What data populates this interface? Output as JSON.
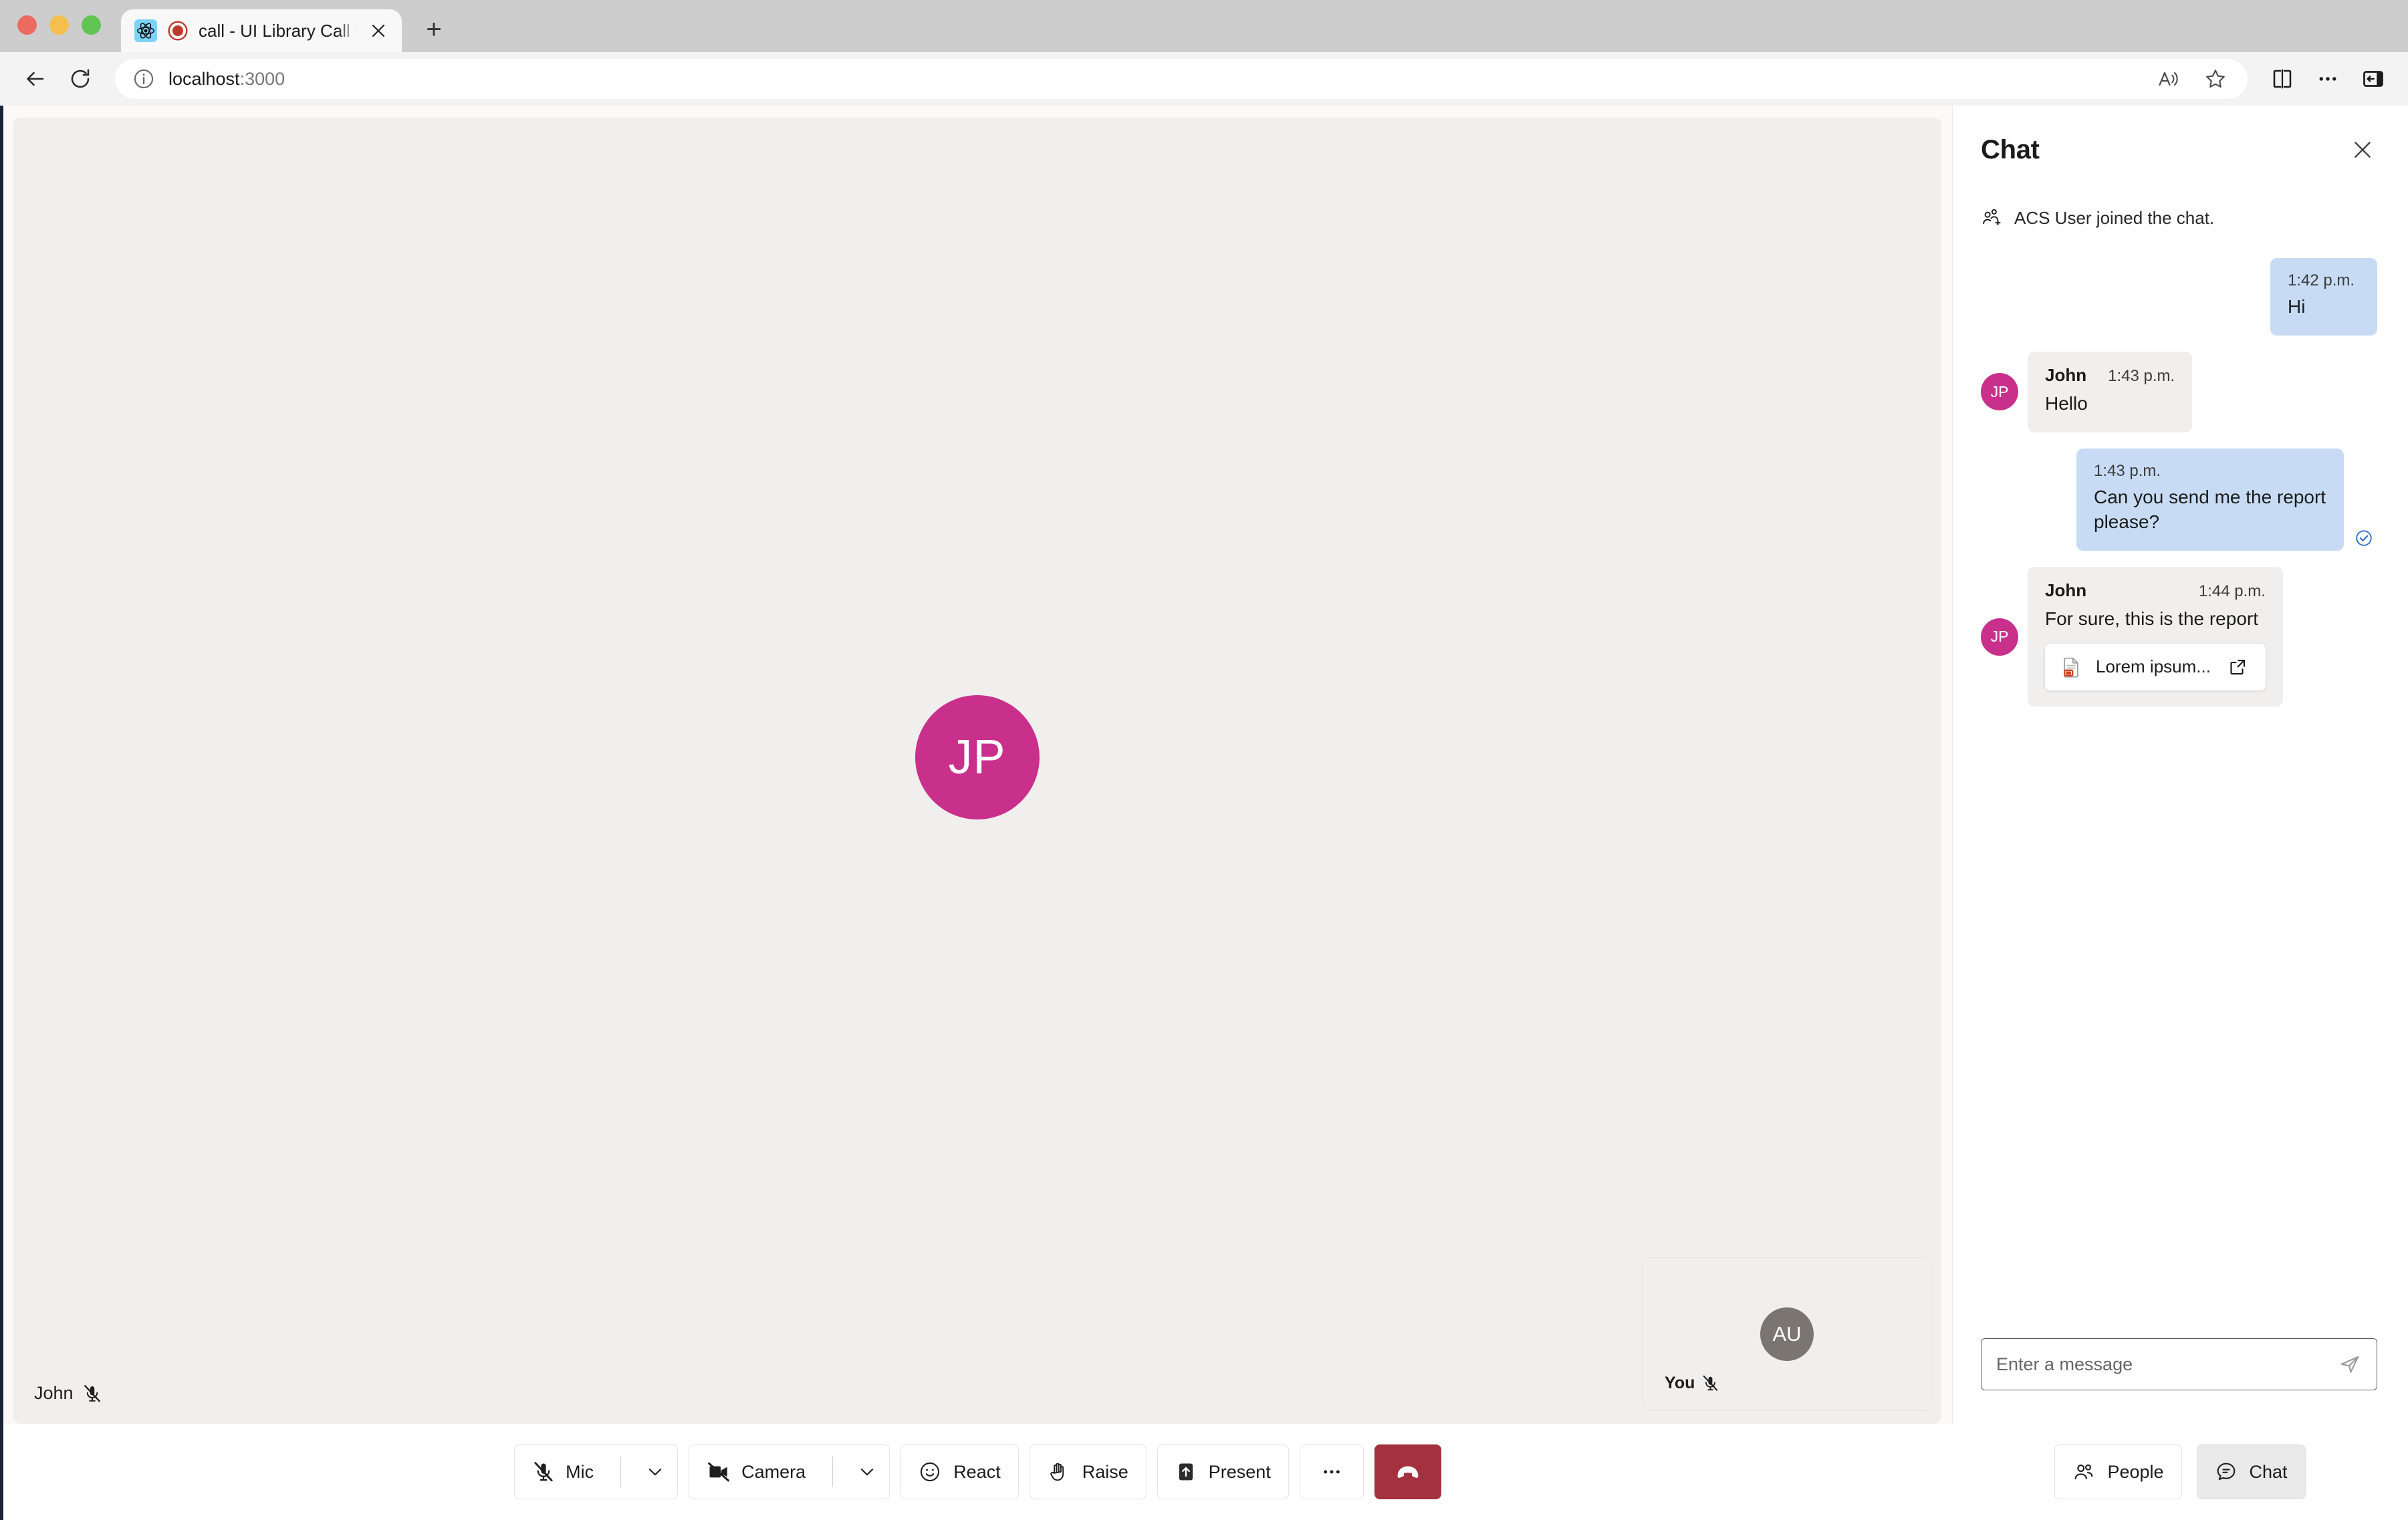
{
  "browser": {
    "tab": {
      "title": "call - UI Library Call With C",
      "favicon_name": "react-icon",
      "recording_name": "recording-indicator-icon",
      "close_name": "tab-close-icon"
    },
    "new_tab_label": "+",
    "toolbar": {
      "back_label": "back-arrow-icon",
      "reload_label": "reload-icon",
      "info_label": "site-info-icon",
      "url_main": "localhost",
      "url_port": ":3000",
      "read_aloud": "read-aloud-icon",
      "favorite": "favorite-star-icon",
      "split_screen": "split-screen-icon",
      "settings": "settings-more-icon",
      "sidebar": "sidebar-toggle-icon"
    }
  },
  "stage": {
    "remote": {
      "initials": "JP",
      "display_name": "John",
      "muted": true,
      "avatar_color": "#c8308c"
    },
    "local": {
      "initials": "AU",
      "display_name": "You",
      "muted": true,
      "avatar_color": "#7b7572"
    }
  },
  "chat": {
    "title": "Chat",
    "close_label": "✕",
    "system_message": "ACS User joined the chat.",
    "messages": [
      {
        "side": "out",
        "time": "1:42 p.m.",
        "text": "Hi",
        "read": false
      },
      {
        "side": "in",
        "initials": "JP",
        "sender": "John",
        "time": "1:43 p.m.",
        "text": "Hello"
      },
      {
        "side": "out",
        "time": "1:43 p.m.",
        "text": "Can you send me the report please?",
        "read": true
      },
      {
        "side": "in",
        "initials": "JP",
        "sender": "John",
        "time": "1:44 p.m.",
        "text": "For sure, this is the report",
        "attachment": "Lorem ipsum..."
      }
    ],
    "input": {
      "value": "",
      "placeholder": "Enter a message",
      "send_label": "send-icon"
    }
  },
  "controls": {
    "mic": {
      "label": "Mic",
      "state": "muted",
      "caret": "⌄"
    },
    "camera": {
      "label": "Camera",
      "state": "off",
      "caret": "⌄"
    },
    "react": {
      "label": "React"
    },
    "raise": {
      "label": "Raise"
    },
    "present": {
      "label": "Present"
    },
    "more": {
      "label": "•••"
    },
    "hangup": {
      "label": ""
    },
    "people": {
      "label": "People"
    },
    "chat": {
      "label": "Chat",
      "active": true
    }
  },
  "colors": {
    "accent_avatar": "#c8308c",
    "bubble_outgoing": "#c7dcf4",
    "bubble_incoming": "#f0efee",
    "hangup_red": "#a4313f",
    "read_receipt_blue": "#2b6fc4"
  }
}
